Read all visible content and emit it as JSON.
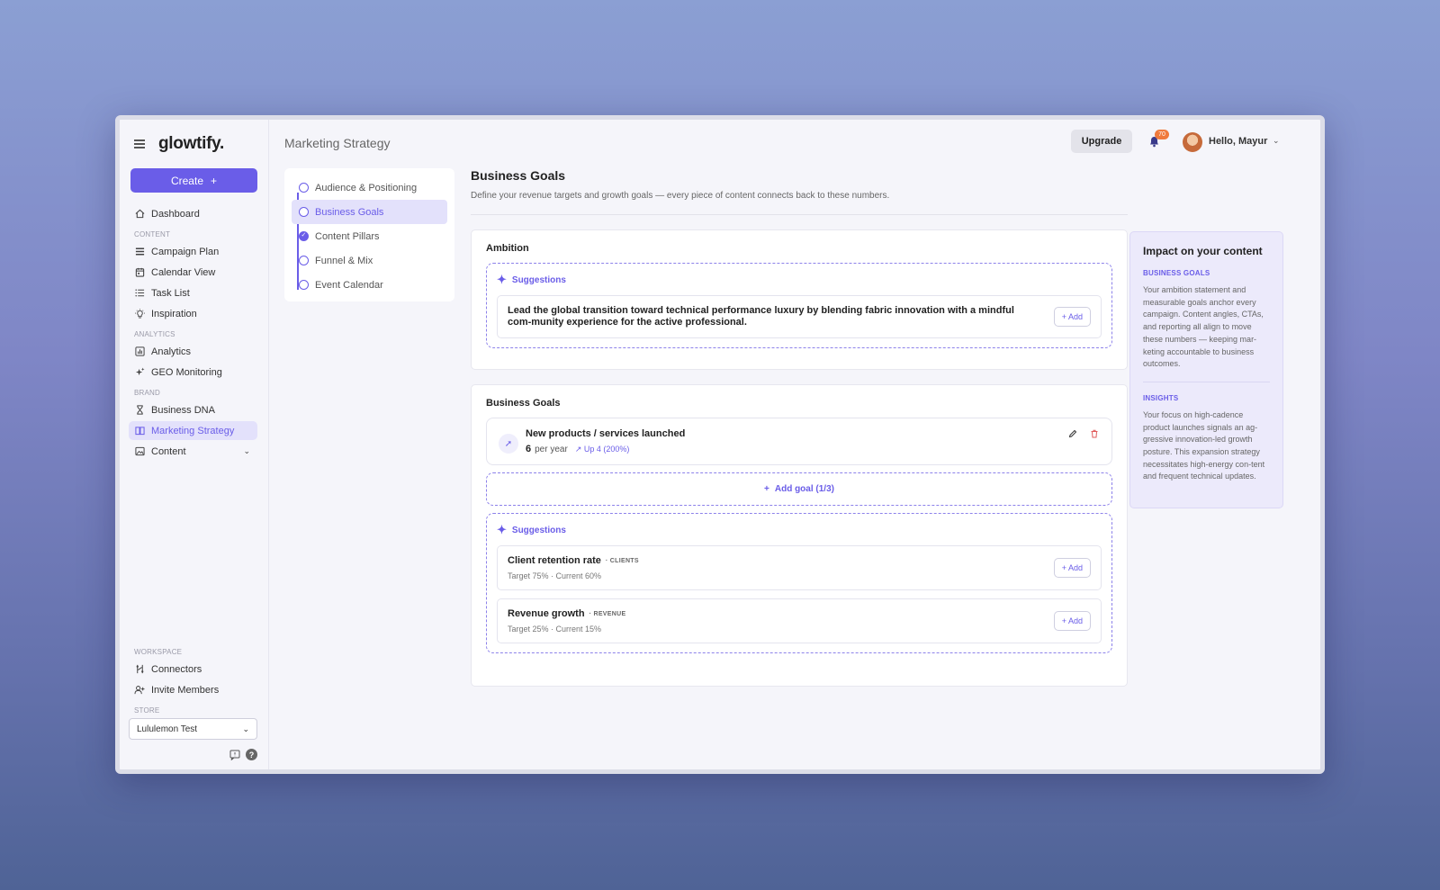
{
  "sidebar": {
    "logo": "glowtify.",
    "create_label": "Create",
    "items": [
      {
        "label": "Dashboard",
        "icon": "home-icon"
      },
      {
        "label": "Campaign Plan",
        "icon": "list-icon"
      },
      {
        "label": "Calendar View",
        "icon": "calendar-icon"
      },
      {
        "label": "Task List",
        "icon": "tasklist-icon"
      },
      {
        "label": "Inspiration",
        "icon": "lightbulb-icon"
      },
      {
        "label": "Analytics",
        "icon": "chart-icon"
      },
      {
        "label": "GEO Monitoring",
        "icon": "sparkle-icon"
      },
      {
        "label": "Business DNA",
        "icon": "hourglass-icon"
      },
      {
        "label": "Marketing Strategy",
        "icon": "book-icon"
      },
      {
        "label": "Content",
        "icon": "image-icon"
      },
      {
        "label": "Connectors",
        "icon": "connector-icon"
      },
      {
        "label": "Invite Members",
        "icon": "invite-icon"
      }
    ],
    "sections": {
      "content": "CONTENT",
      "analytics": "ANALYTICS",
      "brand": "BRAND",
      "workspace": "WORKSPACE",
      "store": "STORE"
    },
    "store_value": "Lululemon Test"
  },
  "header": {
    "title": "Marketing Strategy",
    "upgrade": "Upgrade",
    "notifications": "70",
    "greeting": "Hello, Mayur"
  },
  "steps": [
    {
      "label": "Audience & Positioning"
    },
    {
      "label": "Business Goals"
    },
    {
      "label": "Content Pillars"
    },
    {
      "label": "Funnel & Mix"
    },
    {
      "label": "Event Calendar"
    }
  ],
  "main": {
    "title": "Business Goals",
    "subtitle": "Define your revenue targets and growth goals — every piece of content connects back to these numbers.",
    "ambition": {
      "title": "Ambition",
      "suggestions_label": "Suggestions",
      "text": "Lead the global transition toward technical performance luxury by blending fabric innovation with a mindful com-munity experience for the active professional.",
      "add": "Add"
    },
    "goals": {
      "title": "Business Goals",
      "goal": {
        "name": "New products / services launched",
        "value": "6",
        "unit": "per year",
        "trend": "Up 4 (200%)"
      },
      "add_goal": "Add goal (1/3)",
      "suggestions_label": "Suggestions",
      "suggestions": [
        {
          "name": "Client retention rate",
          "tag": "CLIENTS",
          "meta": "Target 75% · Current 60%",
          "add": "Add"
        },
        {
          "name": "Revenue growth",
          "tag": "REVENUE",
          "meta": "Target 25% · Current 15%",
          "add": "Add"
        }
      ]
    }
  },
  "impact": {
    "title": "Impact on your content",
    "goals_label": "BUSINESS GOALS",
    "goals_text": "Your ambition statement and measurable goals anchor every campaign. Content angles, CTAs, and reporting all align to move these numbers — keeping mar-keting accountable to business outcomes.",
    "insights_label": "INSIGHTS",
    "insights_text": "Your focus on high-cadence product launches signals an ag-gressive innovation-led growth posture. This expansion strategy necessitates high-energy con-tent and frequent technical updates."
  }
}
